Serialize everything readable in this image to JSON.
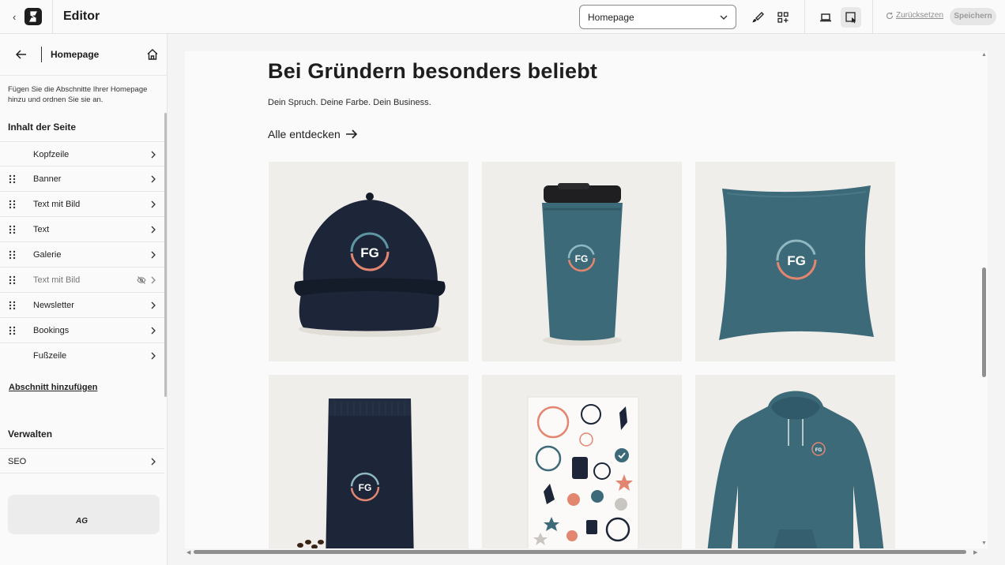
{
  "app": {
    "title": "Editor"
  },
  "toolbar": {
    "page_select": "Homepage",
    "reset_label": "Zurücksetzen",
    "save_label": "Speichern"
  },
  "sidebar": {
    "title": "Homepage",
    "intro": "Fügen Sie die Abschnitte Ihrer Homepage hinzu und ordnen Sie sie an.",
    "content_heading": "Inhalt der Seite",
    "sections": [
      {
        "label": "Kopfzeile",
        "draggable": false,
        "hidden": false
      },
      {
        "label": "Banner",
        "draggable": true,
        "hidden": false
      },
      {
        "label": "Text mit Bild",
        "draggable": true,
        "hidden": false
      },
      {
        "label": "Text",
        "draggable": true,
        "hidden": false
      },
      {
        "label": "Galerie",
        "draggable": true,
        "hidden": false
      },
      {
        "label": "Text mit Bild",
        "draggable": true,
        "hidden": true
      },
      {
        "label": "Newsletter",
        "draggable": true,
        "hidden": false
      },
      {
        "label": "Bookings",
        "draggable": true,
        "hidden": false
      },
      {
        "label": "Fußzeile",
        "draggable": false,
        "hidden": false
      }
    ],
    "add_section": "Abschnitt hinzufügen",
    "manage_heading": "Verwalten",
    "seo_label": "SEO",
    "card_mark": "AG"
  },
  "preview": {
    "headline": "Bei Gründern besonders beliebt",
    "subline": "Dein Spruch. Deine Farbe. Dein Business.",
    "discover_link": "Alle entdecken",
    "logo_text": "FG",
    "products": [
      "cap",
      "tumbler",
      "pillow",
      "coffee-bag",
      "sticker-sheet",
      "hoodie"
    ]
  },
  "colors": {
    "navy": "#1c2638",
    "teal": "#3d6a78",
    "coral": "#e3866f",
    "tile_bg": "#f0eeeb"
  }
}
